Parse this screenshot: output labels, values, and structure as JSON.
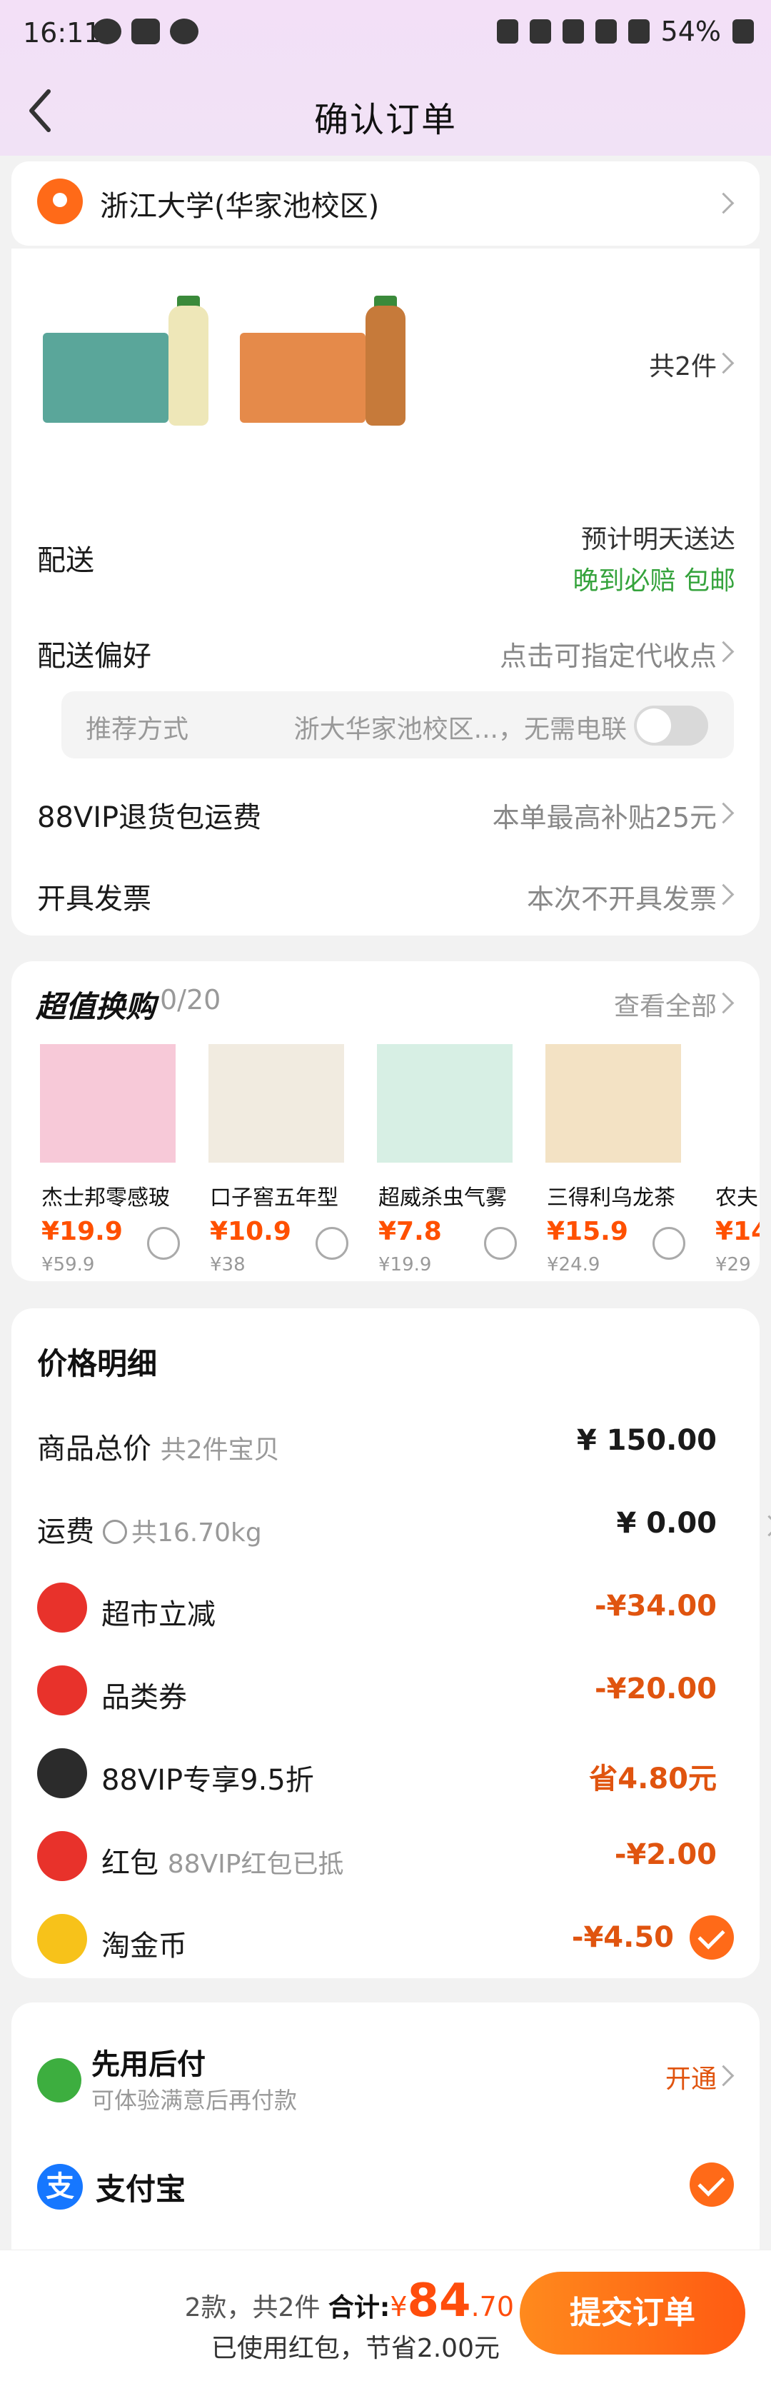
{
  "status_bar": {
    "time": "16:11",
    "battery": "54%"
  },
  "header": {
    "title": "确认订单"
  },
  "address": {
    "text": "浙江大学(华家池校区)"
  },
  "order": {
    "total_items": "共2件",
    "delivery_label": "配送",
    "delivery_eta": "预计明天送达",
    "delivery_guarantee": "晚到必赔  包邮",
    "pref_label": "配送偏好",
    "pref_value": "点击可指定代收点",
    "recommend_label": "推荐方式",
    "recommend_value": "浙大华家池校区...，无需电联",
    "vip_return_label": "88VIP退货包运费",
    "vip_return_value": "本单最高补贴25元",
    "invoice_label": "开具发票",
    "invoice_value": "本次不开具发票"
  },
  "swap": {
    "title": "超值换购",
    "count": "0/20",
    "view_all": "查看全部",
    "items": [
      {
        "name": "杰士邦零感玻",
        "price": "¥19.9",
        "orig": "¥59.9"
      },
      {
        "name": "口子窖五年型",
        "price": "¥10.9",
        "orig": "¥38"
      },
      {
        "name": "超威杀虫气雾",
        "price": "¥7.8",
        "orig": "¥19.9"
      },
      {
        "name": "三得利乌龙茶",
        "price": "¥15.9",
        "orig": "¥24.9"
      },
      {
        "name": "农夫",
        "price": "¥14",
        "orig": "¥29"
      }
    ]
  },
  "price_detail": {
    "title": "价格明细",
    "rows": [
      {
        "label": "商品总价",
        "note": "共2件宝贝",
        "value": "¥ 150.00"
      },
      {
        "label": "运费",
        "note": "共16.70kg",
        "value": "¥ 0.00"
      },
      {
        "label": "超市立减",
        "note": "",
        "value": "-¥34.00"
      },
      {
        "label": "品类券",
        "note": "",
        "value": "-¥20.00"
      },
      {
        "label": "88VIP专享9.5折",
        "note": "",
        "value": "省4.80元"
      },
      {
        "label": "红包",
        "note": "88VIP红包已抵",
        "value": "-¥2.00"
      },
      {
        "label": "淘金币",
        "note": "",
        "value": "-¥4.50"
      }
    ]
  },
  "payment": {
    "paylater_title": "先用后付",
    "paylater_sub": "可体验满意后再付款",
    "paylater_open": "开通",
    "alipay_label": "支付宝"
  },
  "footer": {
    "summary": "2款，共2件",
    "total_label": "合计:",
    "yuan": "¥",
    "amount_int": "84",
    "amount_dec": ".70",
    "saved": "已使用红包，节省2.00元",
    "submit": "提交订单"
  },
  "colors": {
    "accent": "#ff5000",
    "header_bg": "#f3e0f7",
    "green": "#35a33c"
  }
}
